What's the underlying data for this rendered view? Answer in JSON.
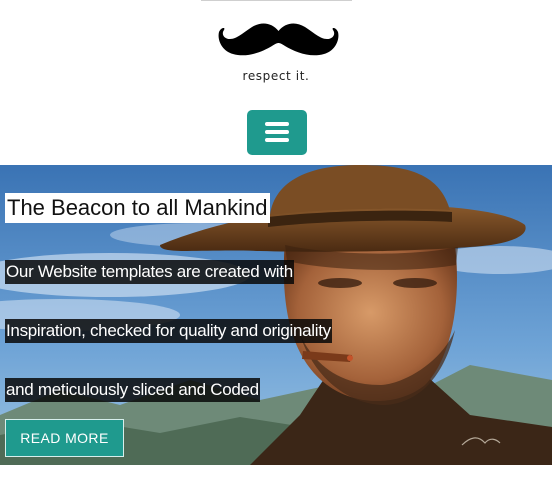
{
  "header": {
    "logo_icon": "mustache-icon",
    "tagline": "respect it.",
    "menu_icon": "hamburger-icon"
  },
  "hero": {
    "title": "The Beacon to all Mankind",
    "lines": [
      "Our Website templates are created with",
      "Inspiration, checked for quality and originality",
      "and meticulously sliced and Coded"
    ],
    "cta_label": "READ MORE"
  },
  "colors": {
    "accent": "#1f9a8e",
    "sky": "#4f88c4",
    "text_dark": "#222222"
  }
}
